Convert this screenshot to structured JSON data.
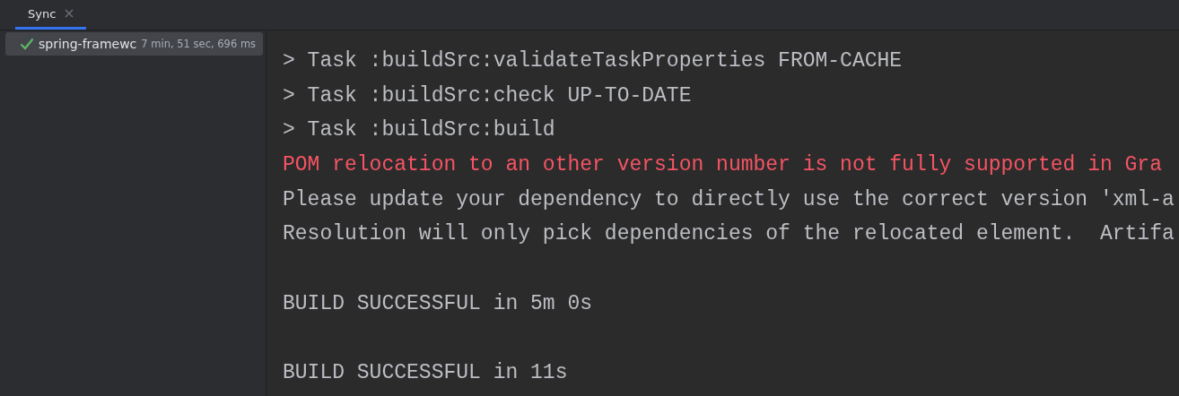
{
  "tabs": [
    {
      "label": "Sync",
      "selected": true
    }
  ],
  "build_tree": [
    {
      "name": "spring-framewc",
      "duration": "7 min, 51 sec, 696 ms",
      "selected": true
    }
  ],
  "console": [
    {
      "text": "> Task :buildSrc:validateTaskProperties FROM-CACHE",
      "kind": "normal"
    },
    {
      "text": "> Task :buildSrc:check UP-TO-DATE",
      "kind": "normal"
    },
    {
      "text": "> Task :buildSrc:build",
      "kind": "normal"
    },
    {
      "text": "POM relocation to an other version number is not fully supported in Gra",
      "kind": "error"
    },
    {
      "text": "Please update your dependency to directly use the correct version 'xml-a",
      "kind": "normal"
    },
    {
      "text": "Resolution will only pick dependencies of the relocated element.  Artifa",
      "kind": "normal"
    },
    {
      "kind": "blank"
    },
    {
      "text": "BUILD SUCCESSFUL in 5m 0s",
      "kind": "normal"
    },
    {
      "kind": "blank"
    },
    {
      "text": "BUILD SUCCESSFUL in 11s",
      "kind": "normal"
    }
  ]
}
